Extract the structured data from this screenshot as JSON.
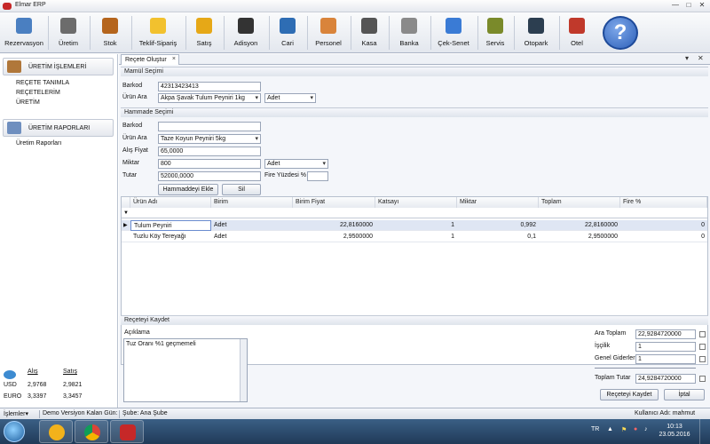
{
  "window": {
    "title": "Elmar ERP"
  },
  "toolbar": {
    "items": [
      {
        "label": "Rezervasyon",
        "color": "#4a7fc1"
      },
      {
        "label": "Üretim",
        "color": "#6c6c6c"
      },
      {
        "label": "Stok",
        "color": "#b5651d"
      },
      {
        "label": "Teklif-Sipariş",
        "color": "#f2c12e"
      },
      {
        "label": "Satış",
        "color": "#e6a817"
      },
      {
        "label": "Adisyon",
        "color": "#333333"
      },
      {
        "label": "Cari",
        "color": "#2e6db4"
      },
      {
        "label": "Personel",
        "color": "#d9843b"
      },
      {
        "label": "Kasa",
        "color": "#555555"
      },
      {
        "label": "Banka",
        "color": "#8a8a8a"
      },
      {
        "label": "Çek-Senet",
        "color": "#3a7bd5"
      },
      {
        "label": "Servis",
        "color": "#7a8a2a"
      },
      {
        "label": "Otopark",
        "color": "#2c3e50"
      },
      {
        "label": "Otel",
        "color": "#c0392b"
      }
    ],
    "help_label": "?"
  },
  "sidebar": {
    "section1": "ÜRETİM İŞLEMLERİ",
    "links1": [
      "REÇETE TANIMLA",
      "REÇETELERİM",
      "ÜRETİM"
    ],
    "section2": "ÜRETİM RAPORLARI",
    "links2": [
      "Üretim Raporları"
    ]
  },
  "currency": {
    "buy_header": "Alış",
    "sell_header": "Satış",
    "rows": [
      {
        "code": "USD",
        "buy": "2,9768",
        "sell": "2,9821"
      },
      {
        "code": "EURO",
        "buy": "3,3397",
        "sell": "3,3457"
      }
    ]
  },
  "tab": {
    "label": "Reçete Oluştur",
    "close": "×"
  },
  "product_section": {
    "header": "Mamül Seçimi",
    "barkod_label": "Barkod",
    "barkod_value": "42313423413",
    "urun_label": "Ürün Ara",
    "urun_value": "Akpa Şavak Tulum Peyniri 1kg",
    "unit_value": "Adet"
  },
  "material_section": {
    "header": "Hammade Seçimi",
    "barkod_label": "Barkod",
    "barkod_value": "",
    "urun_label": "Ürün Ara",
    "urun_value": "Taze Koyun Peyniri 5kg",
    "alis_label": "Alış Fiyat",
    "alis_value": "65,0000",
    "miktar_label": "Miktar",
    "miktar_value": "800",
    "miktar_unit": "Adet",
    "tutar_label": "Tutar",
    "tutar_value": "52000,0000",
    "fire_label": "Fire Yüzdesi %",
    "fire_value": "",
    "add_button": "Hammaddeyi Ekle",
    "delete_button": "Sil"
  },
  "grid": {
    "columns": [
      "Ürün Adı",
      "Birim",
      "Birim Fiyat",
      "Katsayı",
      "Miktar",
      "Toplam",
      "Fire %"
    ],
    "rows": [
      [
        "Tulum Peyniri",
        "Adet",
        "22,8160000",
        "1",
        "0,992",
        "22,8160000",
        "0"
      ],
      [
        "Tuzlu Köy Tereyağı",
        "Adet",
        "2,9500000",
        "1",
        "0,1",
        "2,9500000",
        "0"
      ]
    ]
  },
  "save_section": {
    "header": "Reçeteyi Kaydet",
    "aciklama_label": "Açıklama",
    "aciklama_value": "Tuz Oranı %1 geçmemeli",
    "ara_toplam_label": "Ara Toplam",
    "ara_toplam_value": "22,9284720000",
    "iscilik_label": "İşçilik",
    "iscilik_value": "1",
    "genel_label": "Genel Giderler",
    "genel_value": "1",
    "toplam_label": "Toplam Tutar",
    "toplam_value": "24,9284720000",
    "save_button": "Reçeteyi Kaydet",
    "cancel_button": "İptal"
  },
  "statusbar": {
    "menu": "İşlemler",
    "demo": "Demo Versiyon Kalan Gün:",
    "branch": "Şube: Ana Şube",
    "user": "Kullanıcı Adı: mahmut"
  },
  "taskbar": {
    "lang": "TR",
    "time": "10:13",
    "date": "23.05.2016"
  }
}
